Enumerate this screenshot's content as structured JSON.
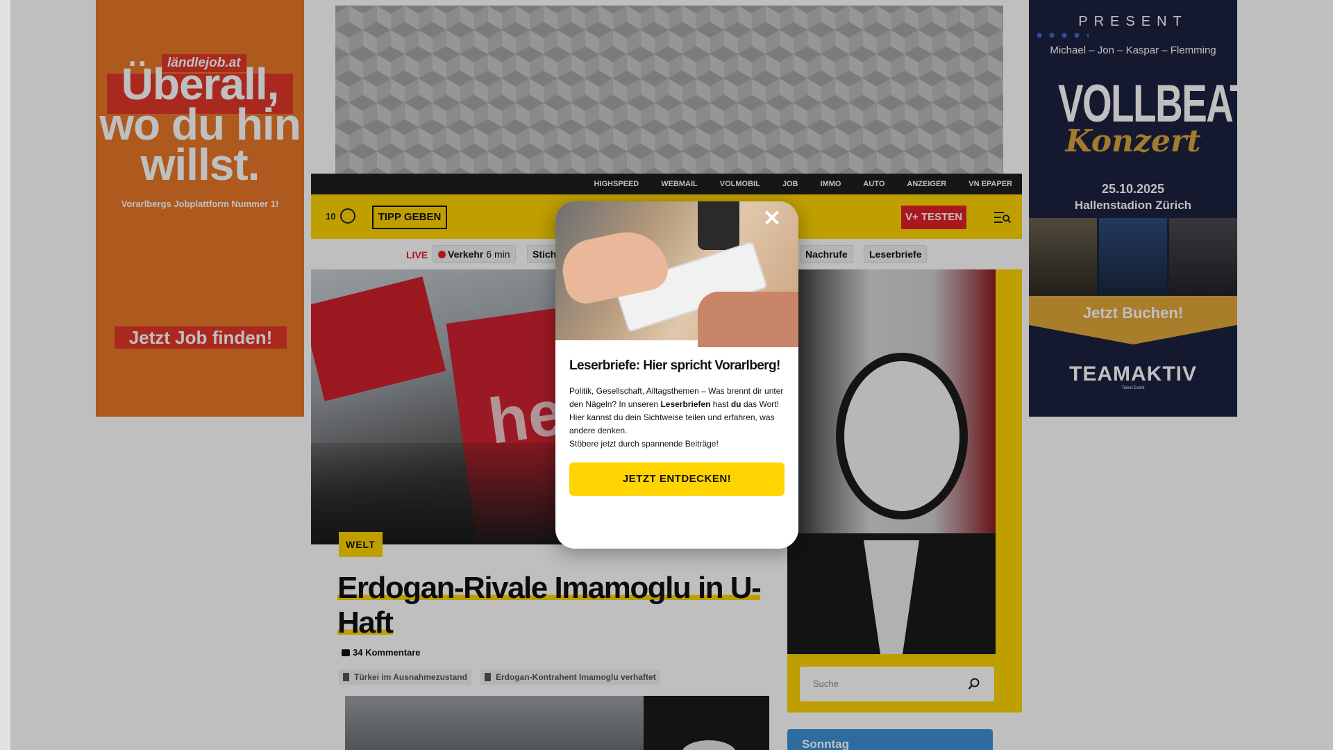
{
  "ads": {
    "left": {
      "brand": "ländlejob.at",
      "headline_lines": [
        "Überall,",
        "wo du hin",
        "willst."
      ],
      "subline": "Vorarlbergs Jobplattform Nummer 1!",
      "cta": "Jetzt Job finden!",
      "colors": {
        "background": "#e8782a",
        "accent": "#e2372a"
      }
    },
    "right": {
      "present": "PRESENT",
      "names": "Michael – Jon – Kaspar – Flemming",
      "band": "VOLLBEAT",
      "subtitle": "Konzert",
      "date": "25.10.2025",
      "venue": "Hallenstadion Zürich",
      "cta": "Jetzt Buchen!",
      "logo": "TEAMAKTIV",
      "logo_sub": "Ticket Event"
    }
  },
  "topbar": {
    "links": [
      "HIGHSPEED",
      "WEBMAIL",
      "VOLMOBIL",
      "JOB",
      "IMMO",
      "AUTO",
      "ANZEIGER",
      "VN EPAPER"
    ]
  },
  "header": {
    "weather_value": "10",
    "weather_icon": "weather-icon",
    "tipp_label": "TIPP GEBEN",
    "vplus_label": "V+ TESTEN",
    "menu_icon": "menu-search-icon",
    "colors": {
      "brand_yellow": "#ffd400",
      "red": "#e3202a"
    }
  },
  "nav": {
    "live_label": "LIVE",
    "chips": [
      {
        "label": "Verkehr",
        "meta": "6 min"
      },
      {
        "label": "Stich"
      },
      {
        "label": "Nachrufe"
      },
      {
        "label": "Leserbriefe"
      }
    ]
  },
  "article": {
    "category": "WELT",
    "title": "Erdogan-Rivale Imamoglu in U-Haft",
    "comments": "34 Kommentare",
    "tags": [
      "Türkei im Ausnahmezustand",
      "Erdogan-Kontrahent Imamoglu verhaftet"
    ],
    "hero_text": "he Ç GÜ"
  },
  "sidebar": {
    "search_placeholder": "Suche",
    "teaser_label": "Sonntag"
  },
  "modal": {
    "close": "✕",
    "title": "Leserbriefe: Hier spricht Vorarlberg!",
    "body_parts": [
      "Politik, Gesellschaft, Alltagsthemen – Was brennt dir unter den Nägeln? In unseren ",
      "Leserbriefen",
      " hast ",
      "du",
      " das Wort! Hier kannst du dein Sichtweise teilen und erfahren, was andere denken."
    ],
    "body_line2": "Stöbere jetzt durch spannende Beiträge!",
    "button": "JETZT ENTDECKEN!"
  }
}
